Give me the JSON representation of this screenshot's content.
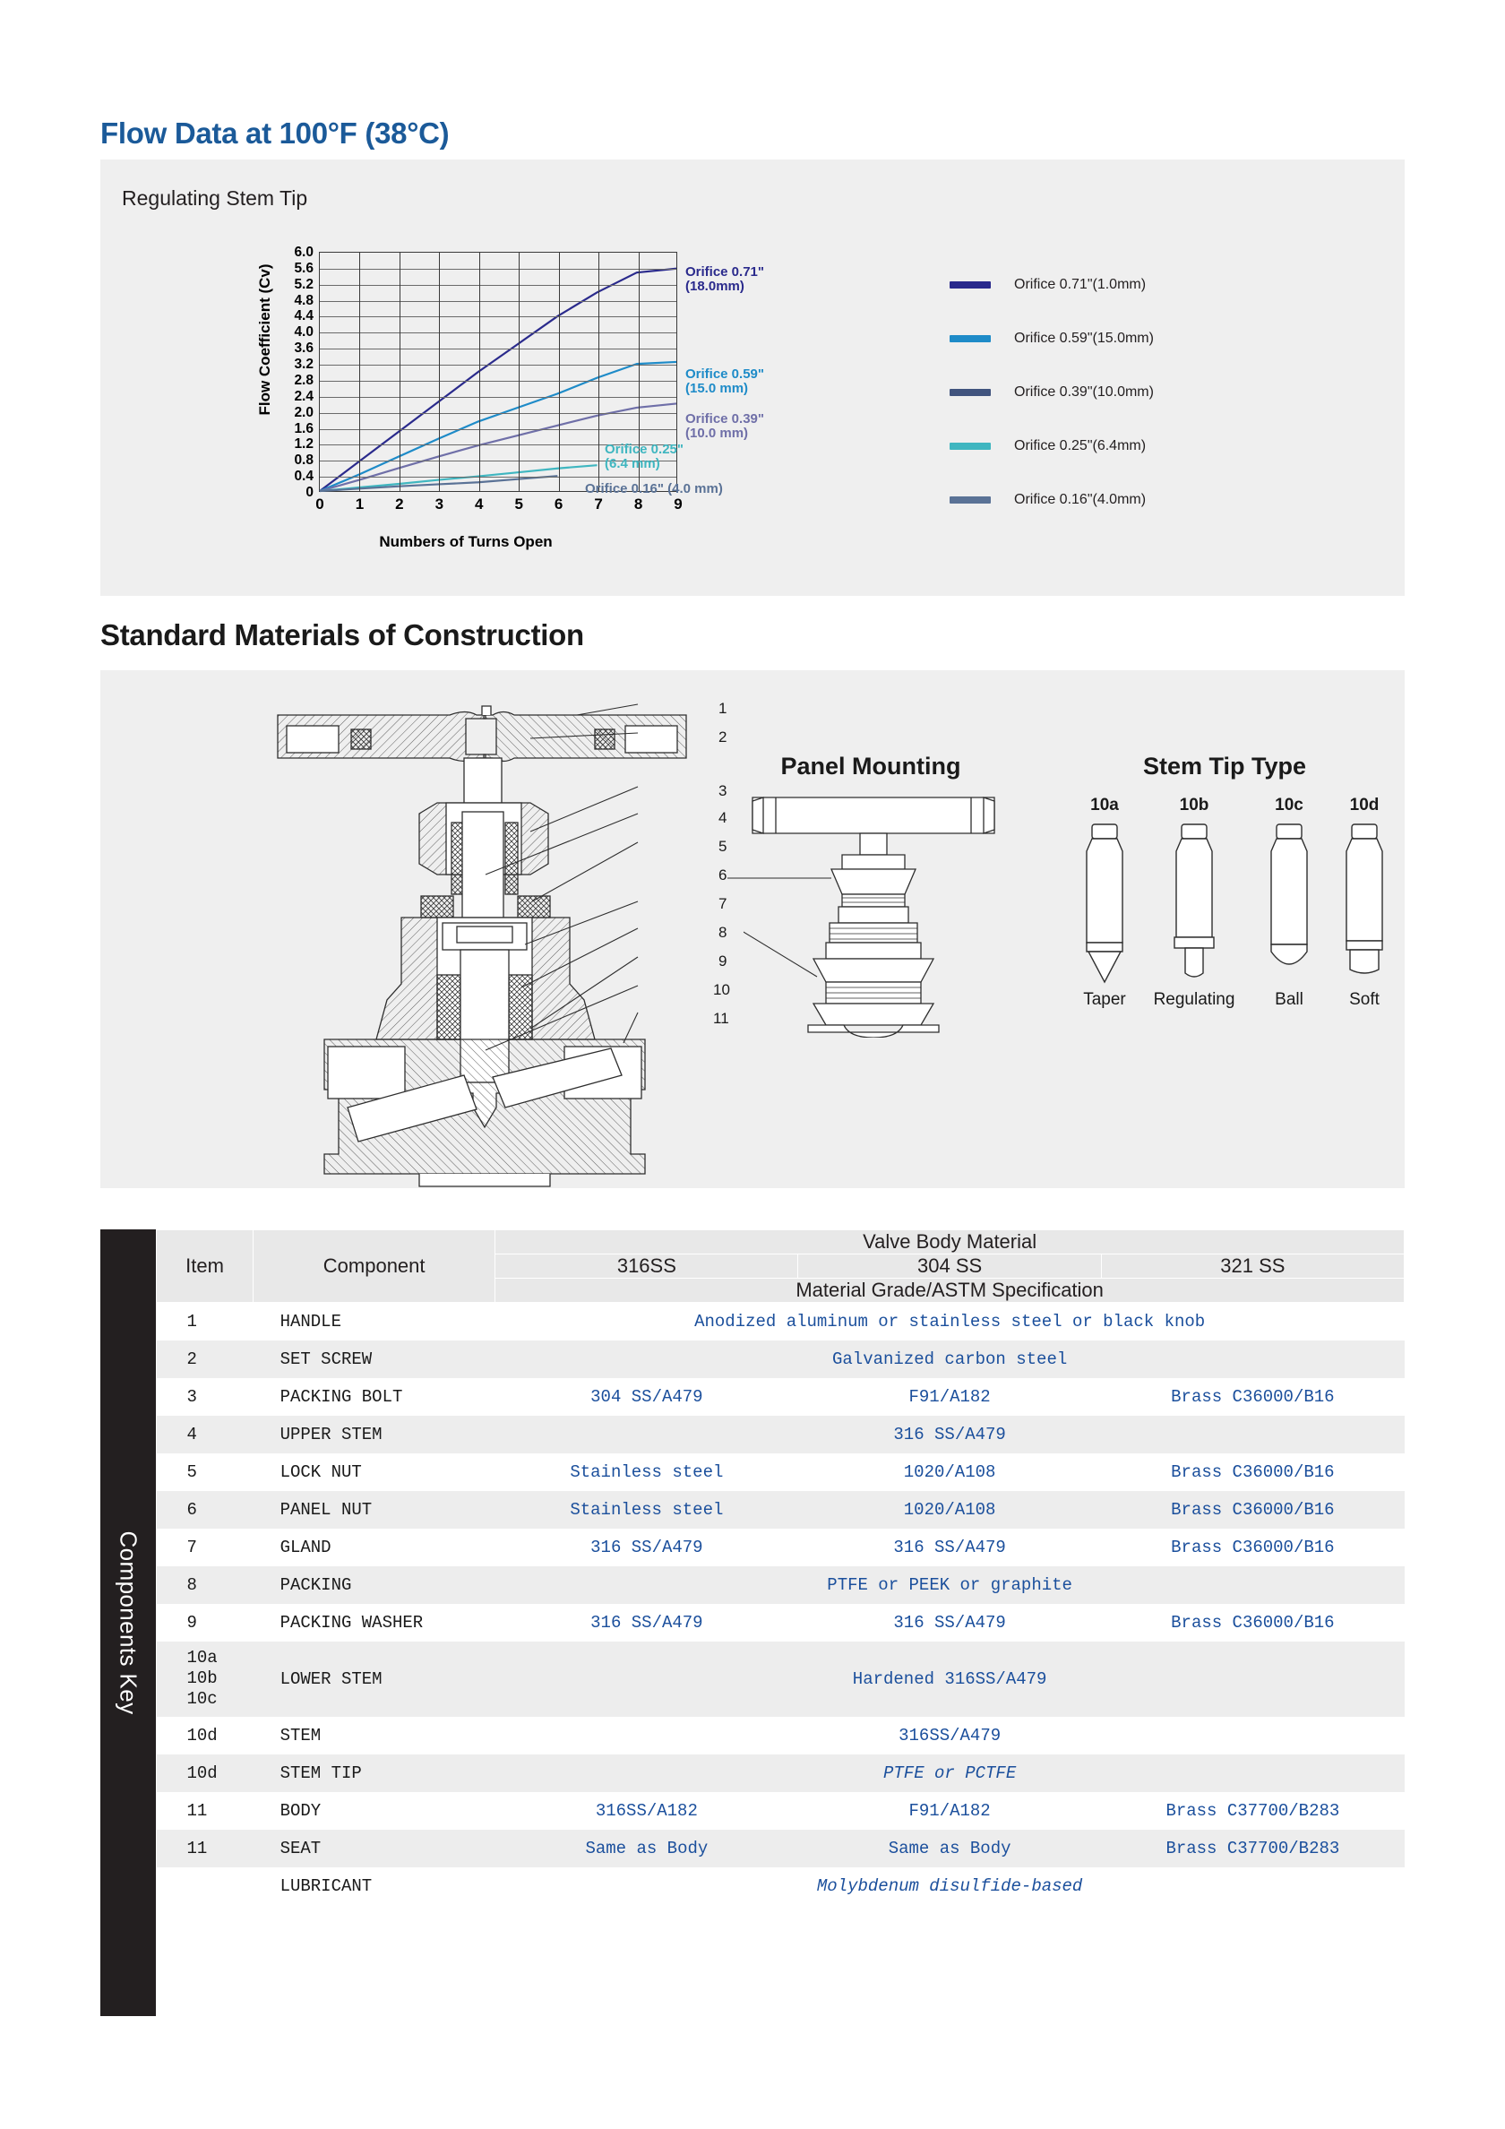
{
  "flow": {
    "title": "Flow Data at 100°F (38°C)",
    "subtitle": "Regulating Stem Tip",
    "accent_color": "#1b5a99"
  },
  "chart_data": {
    "type": "line",
    "title": "",
    "xlabel": "Numbers of Turns Open",
    "ylabel": "Flow Coefficient (Cv)",
    "xlim": [
      0,
      9
    ],
    "ylim": [
      0,
      6.0
    ],
    "xticks": [
      0,
      1,
      2,
      3,
      4,
      5,
      6,
      7,
      8,
      9
    ],
    "yticks": [
      "0",
      "0.4",
      "0.8",
      "1.2",
      "1.6",
      "2.0",
      "2.4",
      "2.8",
      "3.2",
      "3.6",
      "4.0",
      "4.4",
      "4.8",
      "5.2",
      "5.6",
      "6.0"
    ],
    "grid": true,
    "legend_position": "right",
    "series": [
      {
        "name": "Orifice 0.71\"(1.0mm)",
        "color": "#2a2a8c",
        "inline_label": [
          "Orifice 0.71\"",
          "(18.0mm)"
        ],
        "x": [
          0,
          1,
          2,
          3,
          4,
          5,
          6,
          7,
          8,
          9
        ],
        "values": [
          0,
          0.75,
          1.5,
          2.25,
          3.0,
          3.7,
          4.4,
          5.0,
          5.5,
          5.6
        ]
      },
      {
        "name": "Orifice 0.59\"(15.0mm)",
        "color": "#1e8bc8",
        "inline_label": [
          "Orifice 0.59\"",
          "(15.0 mm)"
        ],
        "x": [
          0,
          1,
          2,
          3,
          4,
          5,
          6,
          7,
          8,
          9
        ],
        "values": [
          0,
          0.42,
          0.87,
          1.32,
          1.75,
          2.1,
          2.45,
          2.85,
          3.2,
          3.25
        ]
      },
      {
        "name": "Orifice 0.39\"(10.0mm)",
        "color": "#6f6fa8",
        "inline_label": [
          "Orifice 0.39\"",
          "(10.0 mm)"
        ],
        "x": [
          0,
          1,
          2,
          3,
          4,
          5,
          6,
          7,
          8,
          9
        ],
        "values": [
          0,
          0.28,
          0.58,
          0.87,
          1.15,
          1.4,
          1.65,
          1.9,
          2.1,
          2.2
        ]
      },
      {
        "name": "Orifice 0.25\"(6.4mm)",
        "color": "#3fb6c0",
        "inline_label": [
          "Orifice 0.25\"",
          "(6.4 mm)"
        ],
        "x": [
          0,
          1,
          2,
          3,
          4,
          5,
          6,
          7
        ],
        "values": [
          0,
          0.09,
          0.18,
          0.28,
          0.37,
          0.47,
          0.57,
          0.65
        ]
      },
      {
        "name": "Orifice 0.16\"(4.0mm)",
        "color": "#5a7296",
        "inline_label": [
          "Orifice 0.16\" (4.0 mm)"
        ],
        "x": [
          0,
          1,
          2,
          3,
          4,
          5,
          6
        ],
        "values": [
          0,
          0.06,
          0.12,
          0.17,
          0.22,
          0.3,
          0.38
        ]
      }
    ],
    "legend": [
      {
        "label": "Orifice 0.71\"(1.0mm)",
        "color": "#2a2a8c"
      },
      {
        "label": "Orifice 0.59\"(15.0mm)",
        "color": "#1e8bc8"
      },
      {
        "label": "Orifice 0.39\"(10.0mm)",
        "color": "#41547e"
      },
      {
        "label": "Orifice 0.25\"(6.4mm)",
        "color": "#3fb6c0"
      },
      {
        "label": "Orifice 0.16\"(4.0mm)",
        "color": "#5a7296"
      }
    ]
  },
  "materials": {
    "title": "Standard Materials of Construction",
    "valve_callouts": [
      "1",
      "2",
      "3",
      "4",
      "5",
      "6",
      "7",
      "8",
      "9",
      "10",
      "11"
    ],
    "panel_mounting_heading": "Panel Mounting",
    "stem_tip_heading": "Stem Tip Type",
    "stem_tips": [
      {
        "id": "10a",
        "name": "Taper"
      },
      {
        "id": "10b",
        "name": "Regulating"
      },
      {
        "id": "10c",
        "name": "Ball"
      },
      {
        "id": "10d",
        "name": "Soft"
      }
    ]
  },
  "table": {
    "key_label": "Components Key",
    "group_header": "Valve Body Material",
    "spec_header": "Material Grade/ASTM Specification",
    "col_item": "Item",
    "col_component": "Component",
    "material_cols": [
      "316SS",
      "304 SS",
      "321 SS"
    ],
    "rows": [
      {
        "item": "1",
        "component": "HANDLE",
        "span": "Anodized aluminum or stainless steel or black knob"
      },
      {
        "item": "2",
        "component": "SET SCREW",
        "span": "Galvanized carbon steel"
      },
      {
        "item": "3",
        "component": "PACKING BOLT",
        "v1": "304 SS/A479",
        "v2": "F91/A182",
        "v3": "Brass C36000/B16"
      },
      {
        "item": "4",
        "component": "UPPER STEM",
        "span": "316 SS/A479"
      },
      {
        "item": "5",
        "component": "LOCK NUT",
        "v1": "Stainless steel",
        "v2": "1020/A108",
        "v3": "Brass C36000/B16"
      },
      {
        "item": "6",
        "component": "PANEL NUT",
        "v1": "Stainless steel",
        "v2": "1020/A108",
        "v3": "Brass C36000/B16"
      },
      {
        "item": "7",
        "component": "GLAND",
        "v1": "316 SS/A479",
        "v2": "316 SS/A479",
        "v3": "Brass C36000/B16"
      },
      {
        "item": "8",
        "component": "PACKING",
        "span": "PTFE or PEEK or graphite"
      },
      {
        "item": "9",
        "component": "PACKING WASHER",
        "v1": "316 SS/A479",
        "v2": "316 SS/A479",
        "v3": "Brass C36000/B16"
      },
      {
        "item": "10a\n10b\n10c",
        "component": "LOWER STEM",
        "span": "Hardened 316SS/A479"
      },
      {
        "item": "10d",
        "component": "STEM",
        "span": "316SS/A479"
      },
      {
        "item": "10d",
        "component": "STEM TIP",
        "span": "PTFE or PCTFE",
        "italic": true
      },
      {
        "item": "11",
        "component": "BODY",
        "v1": "316SS/A182",
        "v2": "F91/A182",
        "v3": "Brass C37700/B283"
      },
      {
        "item": "11",
        "component": "SEAT",
        "v1": "Same as Body",
        "v2": "Same as Body",
        "v3": "Brass C37700/B283"
      },
      {
        "item": "",
        "component": "LUBRICANT",
        "span": "Molybdenum disulfide-based",
        "italic": true
      }
    ]
  }
}
